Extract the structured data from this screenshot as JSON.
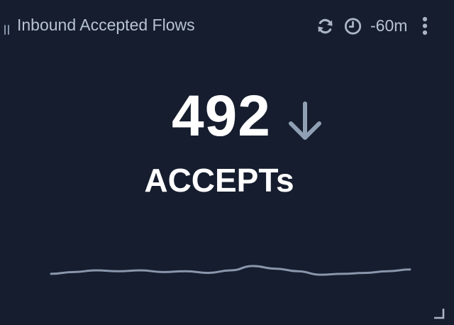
{
  "panel": {
    "title": "Inbound Accepted Flows",
    "time_range": "-60m",
    "value": "492",
    "unit": "ACCEPTs",
    "trend": "down",
    "icons": {
      "drag": "drag-handle-icon",
      "refresh": "refresh-icon",
      "clock": "clock-icon",
      "menu": "kebab-menu-icon",
      "trend": "arrow-down-icon",
      "resize": "resize-corner-icon"
    },
    "colors": {
      "background": "#151d2e",
      "value": "#ffffff",
      "header_text": "#b7c2d2",
      "icon": "#aab5c4",
      "trend_arrow": "#8fa0b4",
      "sparkline": "#8996ac"
    },
    "sparkline": {
      "values": [
        5,
        6,
        7,
        6.5,
        7,
        6,
        6.5,
        5.5,
        7,
        9.5,
        8,
        6.5,
        4.5,
        5,
        5.5,
        6.5,
        7.5
      ]
    }
  }
}
